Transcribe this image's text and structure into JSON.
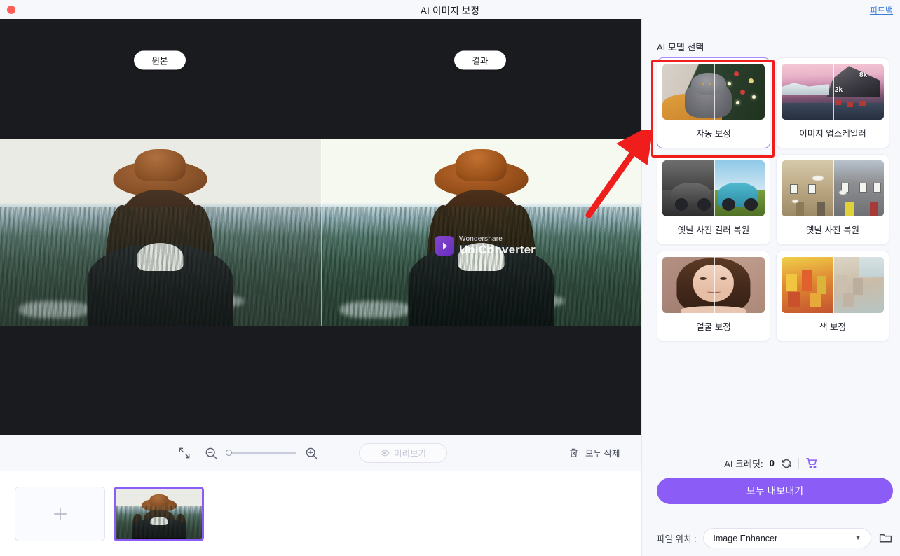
{
  "window": {
    "title": "AI 이미지 보정",
    "close_label": "닫기",
    "feedback_label": "피드백"
  },
  "canvas": {
    "tab_original": "원본",
    "tab_result": "결과",
    "watermark_brand": "Wondershare",
    "watermark_product": "UniConverter"
  },
  "toolbar": {
    "fit_icon": "fit-screen-icon",
    "zoom_out_icon": "zoom-out-icon",
    "zoom_in_icon": "zoom-in-icon",
    "zoom_value": 0,
    "preview_label": "미리보기",
    "preview_icon": "eye-icon",
    "delete_all_label": "모두 삭제",
    "delete_all_icon": "trash-icon"
  },
  "thumbnails": {
    "add_label": "추가",
    "add_icon": "plus-icon",
    "items": [
      {
        "name": "hat-woman-forest",
        "selected": true
      }
    ]
  },
  "panel": {
    "section_title": "AI 모델 선택",
    "models": [
      {
        "label": "자동 보정",
        "art": "art-cat",
        "selected": true
      },
      {
        "label": "이미지 업스케일러",
        "art": "art-up",
        "tag_low": "2k",
        "tag_high": "8k",
        "selected": false
      },
      {
        "label": "옛날 사진 컬러 복원",
        "art": "art-colorize",
        "selected": false
      },
      {
        "label": "옛날 사진 복원",
        "art": "art-restore",
        "selected": false
      },
      {
        "label": "얼굴 보정",
        "art": "art-face",
        "selected": false
      },
      {
        "label": "색 보정",
        "art": "art-color",
        "selected": false
      }
    ],
    "credits_label": "AI 크레딧:",
    "credits_value": "0",
    "refresh_icon": "refresh-icon",
    "cart_icon": "shopping-cart-icon",
    "export_label": "모두 내보내기",
    "file_location_label": "파일 위치 :",
    "file_location_value": "Image Enhancer",
    "folder_icon": "folder-icon",
    "chevron_icon": "chevron-down-icon"
  },
  "annotation": {
    "highlight_color": "#f01d1d",
    "arrow_color": "#f01d1d"
  },
  "colors": {
    "accent": "#8b5cf6",
    "link": "#3b7ddd",
    "canvas_bg": "#1a1b1f",
    "panel_bg": "#f7f8fc"
  }
}
